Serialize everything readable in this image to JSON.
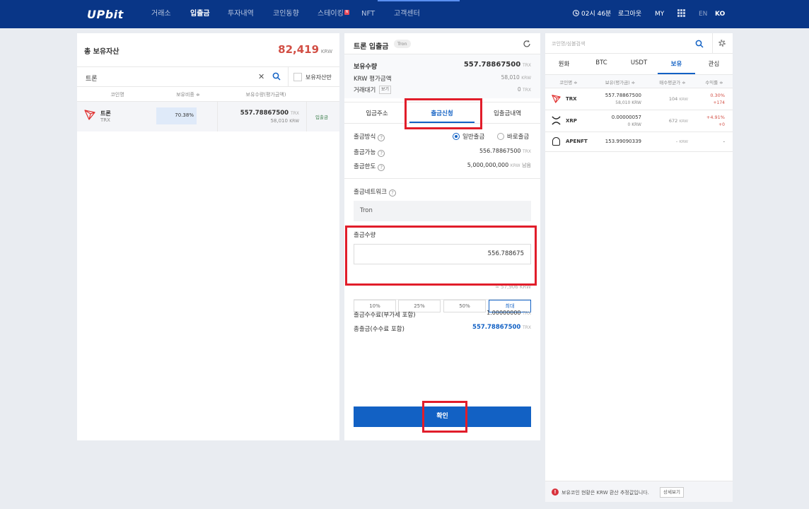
{
  "header": {
    "logo": "UPbit",
    "nav": [
      "거래소",
      "입출금",
      "투자내역",
      "코인동향",
      "스테이킹",
      "NFT",
      "고객센터"
    ],
    "staking_badge": "N",
    "time": "02시 46분",
    "logout": "로그아웃",
    "my": "MY",
    "lang_en": "EN",
    "lang_ko": "KO"
  },
  "assets": {
    "title": "총 보유자산",
    "total_value": "82,419",
    "total_unit": "KRW",
    "search_value": "트론",
    "clear_glyph": "✕",
    "owned_only_label": "보유자산만",
    "columns": [
      "코인명",
      "보유비중 ≑",
      "보유수량(평가금액)"
    ],
    "row": {
      "name": "트론",
      "symbol": "TRX",
      "share": "70.38%",
      "share_fraction": 0.7038,
      "quantity": "557.78867500",
      "quantity_unit": "TRX",
      "value": "58,010",
      "value_unit": "KRW",
      "action": "입출금"
    }
  },
  "withdraw": {
    "title": "트론 입출금",
    "network_tag": "Tron",
    "holding_label": "보유수량",
    "holding_value": "557.78867500",
    "holding_unit": "TRX",
    "krw_label": "KRW 평가금액",
    "krw_value": "58,010",
    "krw_unit": "KRW",
    "pending_label": "거래대기",
    "pending_view": "보기",
    "pending_value": "0",
    "pending_unit": "TRX",
    "tabs": [
      "입금주소",
      "출금신청",
      "입출금내역"
    ],
    "method_label": "출금방식",
    "method_normal": "일반출금",
    "method_instant": "바로출금",
    "available_label": "출금가능",
    "available_value": "556.78867500",
    "available_unit": "TRX",
    "limit_label": "출금한도",
    "limit_value": "5,000,000,000",
    "limit_unit": "KRW",
    "limit_suffix": "남음",
    "network_label": "출금네트워크",
    "network_value": "Tron",
    "amount_label": "출금수량",
    "amount_value": "556.788675",
    "pct_buttons": [
      "10%",
      "25%",
      "50%",
      "최대"
    ],
    "approx_value": "≈ 57,906 KRW",
    "fee_label": "출금수수료(부가세 포함)",
    "fee_value": "1.00000000",
    "fee_unit": "TRX",
    "total_label": "총출금(수수료 포함)",
    "total_value": "557.78867500",
    "total_unit": "TRX",
    "confirm": "확인",
    "help_glyph": "?"
  },
  "market": {
    "search_placeholder": "코인명/심볼검색",
    "tabs": [
      "원화",
      "BTC",
      "USDT",
      "보유",
      "관심"
    ],
    "columns": [
      "코인명 ≑",
      "보유(평가금) ≑",
      "매수평균가 ≑",
      "수익률 ≑"
    ],
    "rows": [
      {
        "symbol": "TRX",
        "qty": "557.78867500",
        "krw": "58,010 KRW",
        "avg": "104",
        "avg_unit": "KRW",
        "rate": "0.30%",
        "profit": "+174"
      },
      {
        "symbol": "XRP",
        "qty": "0.00000057",
        "krw": "0 KRW",
        "avg": "672",
        "avg_unit": "KRW",
        "rate": "+4.91%",
        "profit": "+0"
      },
      {
        "symbol": "APENFT",
        "qty": "153.99090339",
        "krw": "",
        "avg": "-",
        "avg_unit": "KRW",
        "rate": "-",
        "profit": ""
      }
    ],
    "notice": "보유코인 현황은 KRW 환산 추정값입니다.",
    "notice_btn": "상세보기"
  },
  "colors": {
    "header_bg": "#093687",
    "accent_blue": "#1261c4",
    "rise_red": "#d24f45",
    "highlight_box": "#e11d2a"
  }
}
